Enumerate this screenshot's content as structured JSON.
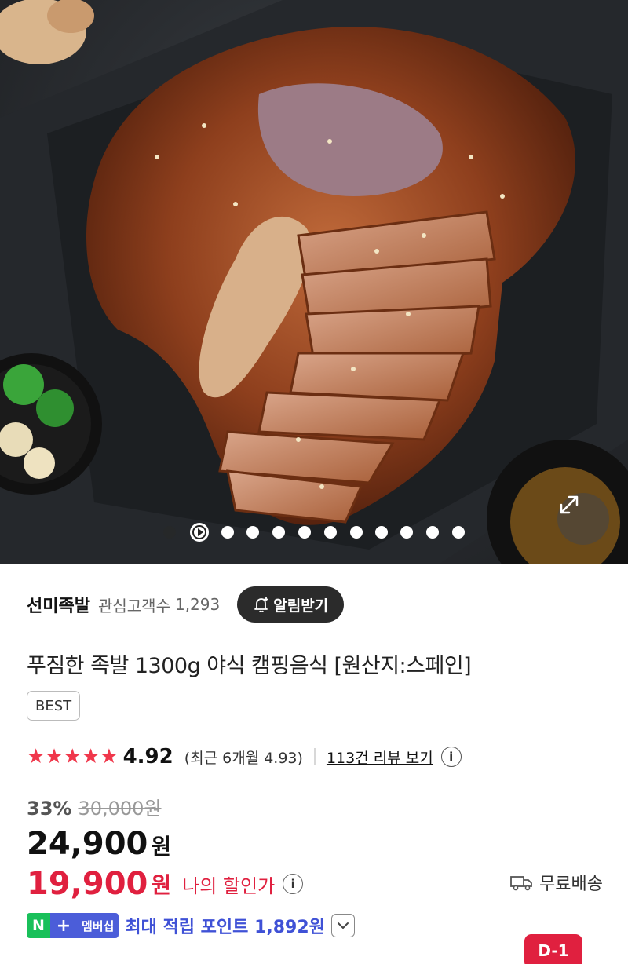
{
  "gallery": {
    "image_alt": "족발 상품 이미지",
    "slide_count": 12,
    "current_slide": 1
  },
  "seller": {
    "name": "선미족발",
    "followers_label": "관심고객수",
    "followers_count": "1,293",
    "alert_button": "알림받기"
  },
  "product": {
    "title": "푸짐한 족발 1300g 야식 캠핑음식 [원산지:스페인]",
    "badge": "BEST"
  },
  "rating": {
    "stars": 5,
    "score": "4.92",
    "recent": "(최근 6개월 4.93)",
    "review_link": "113건 리뷰 보기",
    "info_icon": "i"
  },
  "price": {
    "discount_rate": "33%",
    "original": "30,000원",
    "sale": "24,900",
    "sale_unit": "원",
    "my_price": "19,900",
    "my_unit": "원",
    "my_label": "나의 할인가",
    "free_shipping": "무료배송"
  },
  "membership": {
    "n_label": "N",
    "plus_label": "+",
    "tag": "멤버십",
    "points_text": "최대 적립 포인트 1,892원"
  },
  "dday": "D-1",
  "colors": {
    "accent_red": "#e0203f",
    "star": "#f0374b",
    "naver_green": "#19c05a",
    "member_blue": "#4b5dd9"
  }
}
